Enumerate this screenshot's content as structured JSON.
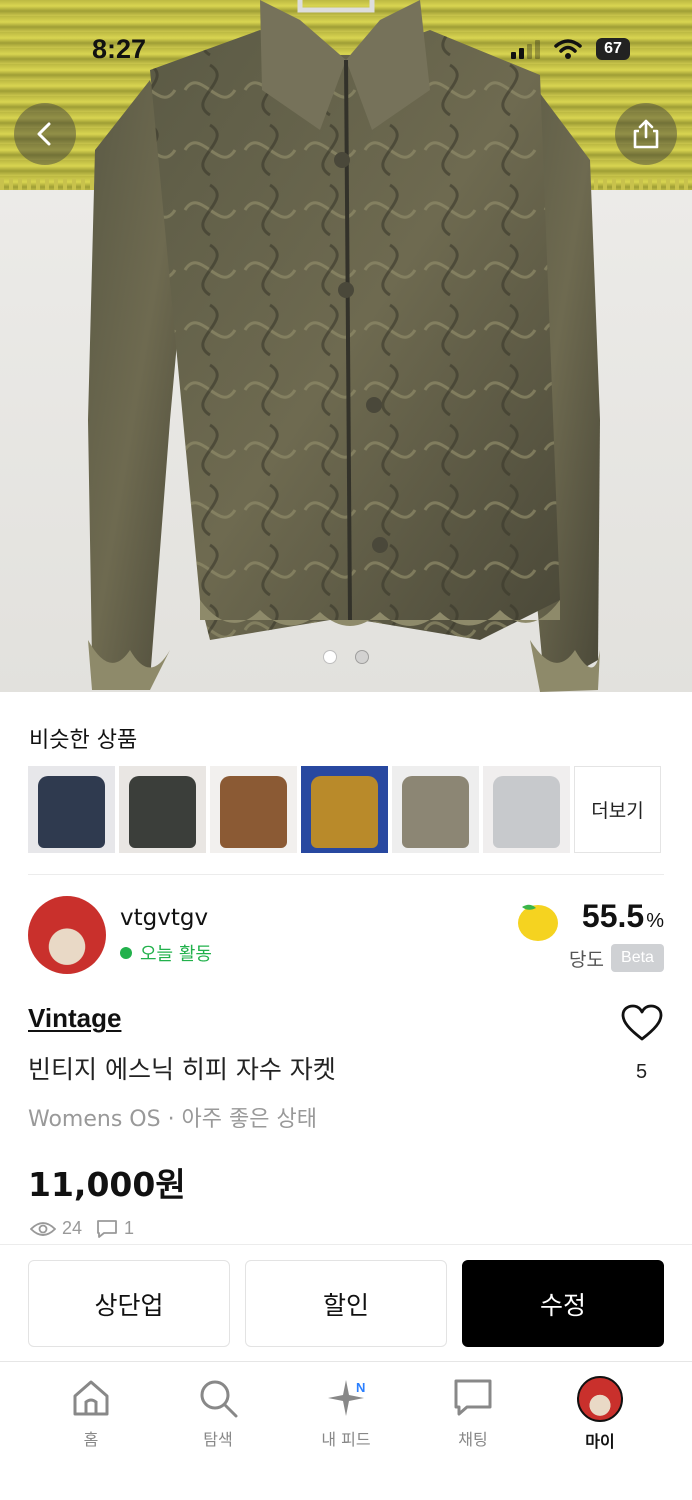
{
  "status_bar": {
    "time": "8:27",
    "battery": "67"
  },
  "similar": {
    "title": "비슷한 상품",
    "more_label": "더보기",
    "thumbnails": [
      {
        "color": "#2f3a4f"
      },
      {
        "color": "#3b3e3a"
      },
      {
        "color": "#8b5a34"
      },
      {
        "color": "#b98a2a"
      },
      {
        "color": "#8c8674"
      },
      {
        "color": "#c7c9cc"
      }
    ]
  },
  "seller": {
    "name": "vtgvtgv",
    "status": "오늘 활동",
    "sweetness_value": "55.5",
    "sweetness_unit": "%",
    "sweetness_label": "당도",
    "beta_badge": "Beta"
  },
  "product": {
    "brand": "Vintage",
    "title": "빈티지 에스닉 히피 자수 자켓",
    "meta": "Womens OS · 아주 좋은 상태",
    "price": "11,000원",
    "likes": "5",
    "views": "24",
    "comments": "1"
  },
  "actions": {
    "bump_label": "상단업",
    "discount_label": "할인",
    "edit_label": "수정"
  },
  "tabbar": {
    "items": [
      {
        "label": "홈"
      },
      {
        "label": "탐색"
      },
      {
        "label": "내 피드",
        "badge": "N"
      },
      {
        "label": "채팅"
      },
      {
        "label": "마이"
      }
    ]
  },
  "colors": {
    "online": "#22b14c",
    "primary_button": "#000000"
  }
}
